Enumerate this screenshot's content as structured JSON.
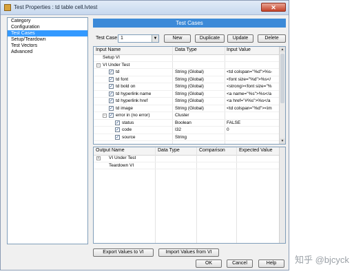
{
  "window": {
    "title": "Test Properties : td table cell.lvtest"
  },
  "category": {
    "header": "Category",
    "items": [
      "Configuration",
      "Test Cases",
      "Setup/Teardown",
      "Test Vectors",
      "Advanced"
    ],
    "selected": "Test Cases"
  },
  "panel": {
    "title": "Test Cases"
  },
  "test_case": {
    "label": "Test Case",
    "value": "1",
    "buttons": [
      "New",
      "Duplicate",
      "Update",
      "Delete"
    ]
  },
  "inputs": {
    "columns": [
      "Input Name",
      "Data Type",
      "Input Value"
    ],
    "rows": [
      {
        "name": "Setup VI",
        "type": "",
        "value": "",
        "indent": 1,
        "checked": false,
        "tree": "line"
      },
      {
        "name": "VI Under Test",
        "type": "",
        "value": "",
        "indent": 1,
        "checked": false,
        "tree": "minus"
      },
      {
        "name": "td",
        "type": "String (Global)",
        "value": "<td colspan=\"%d\">%s-",
        "indent": 2,
        "checked": true,
        "tree": ""
      },
      {
        "name": "td font",
        "type": "String (Global)",
        "value": "<font size=\"%d\">%s</",
        "indent": 2,
        "checked": true,
        "tree": ""
      },
      {
        "name": "td bold on",
        "type": "String (Global)",
        "value": "<strong><font size=\"%",
        "indent": 2,
        "checked": true,
        "tree": ""
      },
      {
        "name": "td hyperlink name",
        "type": "String (Global)",
        "value": "<a name=\"%s\">%s</a",
        "indent": 2,
        "checked": true,
        "tree": ""
      },
      {
        "name": "td hyperlink href",
        "type": "String (Global)",
        "value": "<a href=\"#%s\">%s</a",
        "indent": 2,
        "checked": true,
        "tree": ""
      },
      {
        "name": "td image",
        "type": "String (Global)",
        "value": "<td colspan=\"%d\"><im",
        "indent": 2,
        "checked": true,
        "tree": ""
      },
      {
        "name": "error in (no error)",
        "type": "Cluster",
        "value": "",
        "indent": 2,
        "checked": true,
        "tree": "minus"
      },
      {
        "name": "status",
        "type": "Boolean",
        "value": "FALSE",
        "indent": 3,
        "checked": true,
        "tree": ""
      },
      {
        "name": "code",
        "type": "I32",
        "value": "0",
        "indent": 3,
        "checked": true,
        "tree": ""
      },
      {
        "name": "source",
        "type": "String",
        "value": "",
        "indent": 3,
        "checked": true,
        "tree": ""
      }
    ]
  },
  "outputs": {
    "columns": [
      "Output Name",
      "Data Type",
      "Comparison",
      "Expected Value"
    ],
    "rows": [
      {
        "name": "VI Under Test",
        "tree": "plus"
      },
      {
        "name": "Teardown VI",
        "tree": "line"
      }
    ]
  },
  "footer": {
    "export_label": "Export Values to VI",
    "import_label": "Import Values from VI",
    "ok_label": "OK",
    "cancel_label": "Cancel",
    "help_label": "Help"
  },
  "watermark": "知乎 @bjcyck"
}
